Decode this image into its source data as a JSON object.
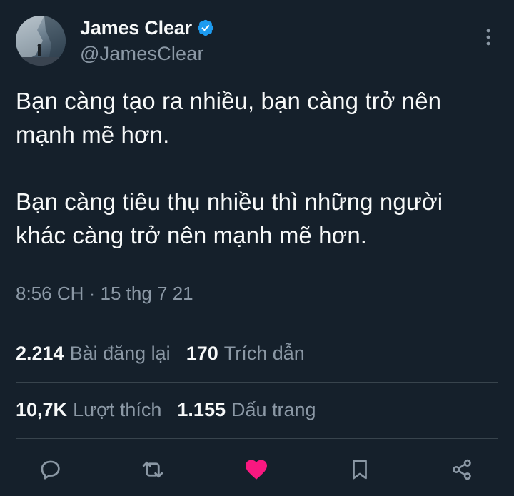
{
  "author": {
    "display_name": "James Clear",
    "handle": "@JamesClear",
    "verified_icon": "verified-badge-icon",
    "avatar_icon": "avatar"
  },
  "tweet": {
    "text": "Bạn càng tạo ra nhiều, bạn càng trở nên\nmạnh mẽ hơn.\n\nBạn càng tiêu thụ nhiều thì những người\nkhác càng trở nên mạnh mẽ hơn.",
    "time": "8:56 CH",
    "separator": " · ",
    "date": "15 thg 7 21"
  },
  "stats": {
    "reposts_count": "2.214",
    "reposts_label": "Bài đăng lại",
    "quotes_count": "170",
    "quotes_label": "Trích dẫn",
    "likes_count": "10,7K",
    "likes_label": "Lượt thích",
    "bookmarks_count": "1.155",
    "bookmarks_label": "Dấu trang"
  },
  "actions": [
    "reply-icon",
    "repost-icon",
    "like-icon",
    "bookmark-icon",
    "share-icon"
  ],
  "colors": {
    "background": "#15202b",
    "text": "#f7f9f9",
    "secondary": "#8b98a5",
    "divider": "#38444d",
    "verified": "#1d9bf0",
    "like": "#f91880"
  }
}
